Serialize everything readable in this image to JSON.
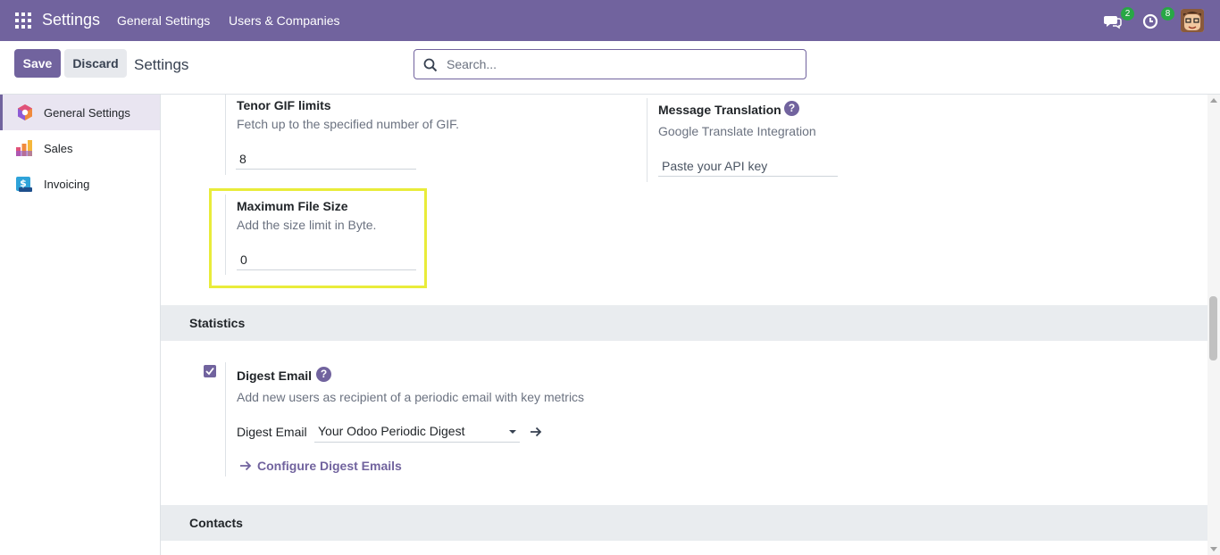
{
  "navbar": {
    "brand": "Settings",
    "menu": [
      "General Settings",
      "Users & Companies"
    ],
    "messages_count": "2",
    "activities_count": "8"
  },
  "control_panel": {
    "save_label": "Save",
    "discard_label": "Discard",
    "breadcrumb": "Settings",
    "search_placeholder": "Search..."
  },
  "sidebar": {
    "items": [
      {
        "label": "General Settings",
        "icon": "general-settings-icon",
        "active": true
      },
      {
        "label": "Sales",
        "icon": "sales-icon",
        "active": false
      },
      {
        "label": "Invoicing",
        "icon": "invoicing-icon",
        "active": false
      }
    ]
  },
  "settings": {
    "tenor": {
      "title": "Tenor GIF limits",
      "description": "Fetch up to the specified number of GIF.",
      "value": "8"
    },
    "translation": {
      "title": "Message Translation",
      "description": "Google Translate Integration",
      "placeholder": "Paste your API key"
    },
    "max_file_size": {
      "title": "Maximum File Size",
      "description": "Add the size limit in Byte.",
      "value": "0"
    }
  },
  "statistics": {
    "header": "Statistics",
    "digest": {
      "title": "Digest Email",
      "checked": true,
      "description": "Add new users as recipient of a periodic email with key metrics",
      "field_label": "Digest Email",
      "selected": "Your Odoo Periodic Digest",
      "configure_link": "Configure Digest Emails"
    }
  },
  "contacts": {
    "header": "Contacts"
  },
  "colors": {
    "primary": "#71639e",
    "highlight": "#e9ec3a",
    "badge": "#28a745"
  }
}
